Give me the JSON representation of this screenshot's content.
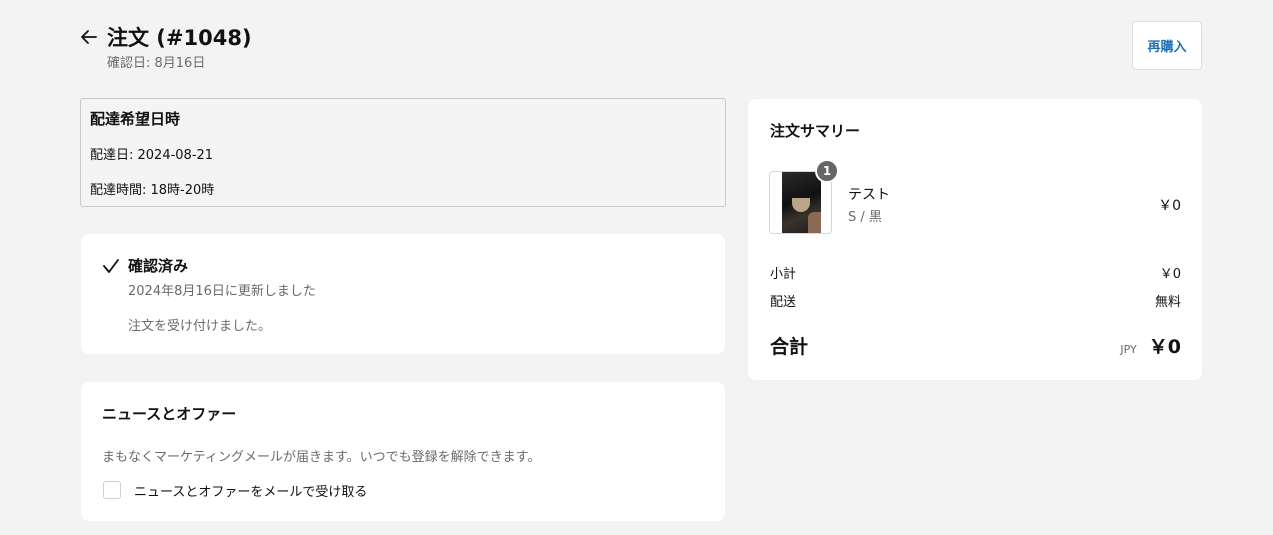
{
  "header": {
    "title": "注文 (#1048)",
    "subtitle": "確認日: 8月16日",
    "reorder_label": "再購入"
  },
  "delivery": {
    "heading": "配達希望日時",
    "date_line": "配達日: 2024-08-21",
    "time_line": "配達時間: 18時-20時"
  },
  "status": {
    "heading": "確認済み",
    "updated": "2024年8月16日に更新しました",
    "message": "注文を受け付けました。"
  },
  "news": {
    "heading": "ニュースとオファー",
    "description": "まもなくマーケティングメールが届きます。いつでも登録を解除できます。",
    "checkbox_label": "ニュースとオファーをメールで受け取る",
    "checked": false
  },
  "summary": {
    "heading": "注文サマリー",
    "item": {
      "quantity": "1",
      "name": "テスト",
      "variant": "S / 黒",
      "price": "￥0"
    },
    "subtotal_label": "小計",
    "subtotal_value": "￥0",
    "shipping_label": "配送",
    "shipping_value": "無料",
    "total_label": "合計",
    "currency": "JPY",
    "total_value": "￥0"
  },
  "icons": {
    "back": "arrow-left-icon",
    "status": "check-icon"
  },
  "colors": {
    "accent": "#1f6fb3",
    "background": "#f3f3f3"
  }
}
